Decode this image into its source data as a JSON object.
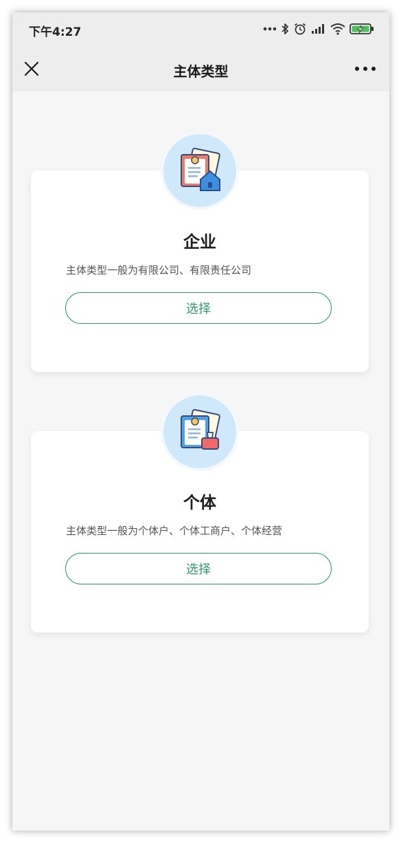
{
  "status_bar": {
    "time": "下午4:27",
    "icons": [
      "more-dots-icon",
      "bluetooth-icon",
      "alarm-icon",
      "signal-icon",
      "wifi-icon",
      "battery-charging-icon"
    ]
  },
  "nav": {
    "title": "主体类型",
    "close_icon": "close-icon",
    "more_icon": "more-icon"
  },
  "options": [
    {
      "title": "企业",
      "description": "主体类型一般为有限公司、有限责任公司",
      "button_label": "选择",
      "icon": "enterprise-icon"
    },
    {
      "title": "个体",
      "description": "主体类型一般为个体户、个体工商户、个体经营",
      "button_label": "选择",
      "icon": "individual-icon"
    }
  ],
  "colors": {
    "accent": "#2e9a6c",
    "page_background": "#f6f6f6",
    "nav_background": "#ededed",
    "icon_circle": "#cfe9fb"
  }
}
